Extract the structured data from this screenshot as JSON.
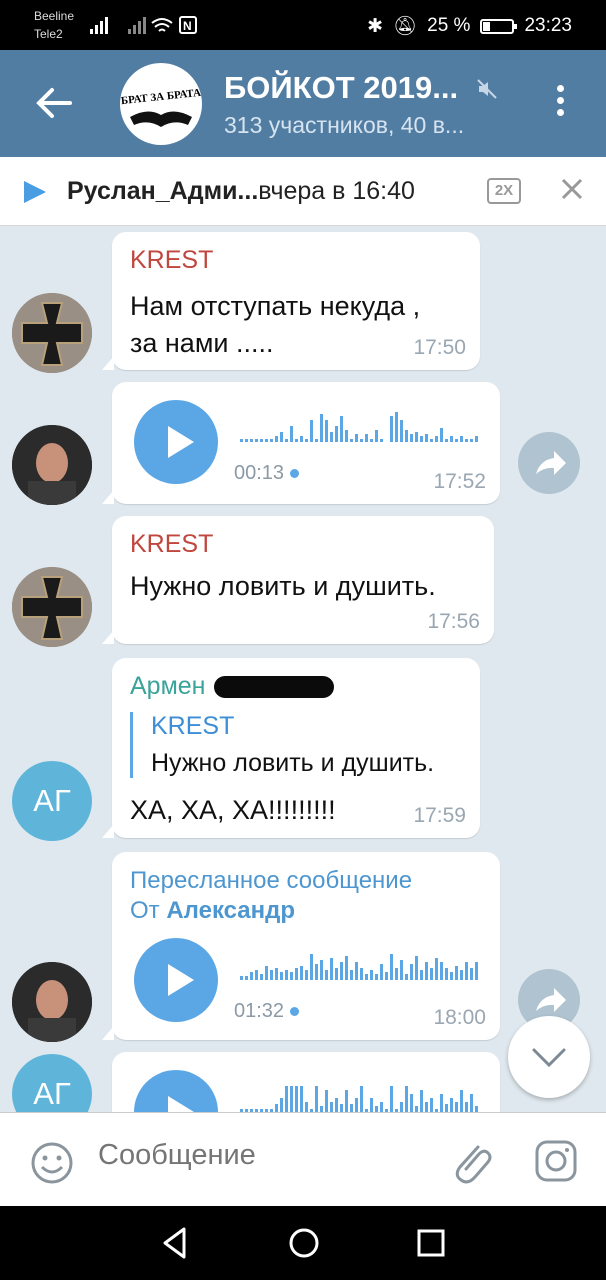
{
  "status": {
    "carrier1": "Beeline",
    "carrier2": "Tele2",
    "battery": "25 %",
    "time": "23:23"
  },
  "header": {
    "title": "БОЙКОТ 2019...",
    "subtitle": "313 участников, 40 в...",
    "avatar_text": "БРАТ ЗА БРАТА"
  },
  "player": {
    "name": "Руслан_Адми...",
    "when": "вчера в 16:40",
    "speed": "2X"
  },
  "messages": [
    {
      "sender": "KREST",
      "text1": "Нам отступать некуда ,",
      "text2": "за нами .....",
      "time": "17:50"
    },
    {
      "duration": "00:13",
      "time": "17:52"
    },
    {
      "sender": "KREST",
      "text": "Нужно ловить и душить.",
      "time": "17:56"
    },
    {
      "sender": "Армен",
      "reply_name": "KREST",
      "reply_text": "Нужно ловить и душить.",
      "text": "ХА, ХА, ХА!!!!!!!!!",
      "time": "17:59",
      "avatar": "АГ"
    },
    {
      "fwd_label": "Пересланное сообщение",
      "fwd_from_prefix": "От ",
      "fwd_from": "Александр",
      "duration": "01:32",
      "time": "18:00"
    },
    {
      "avatar": "АГ"
    }
  ],
  "input": {
    "placeholder": "Сообщение"
  },
  "colors": {
    "header": "#527da3",
    "accent": "#5ba7e6",
    "krest": "#c0463e",
    "armen": "#3aa39a"
  }
}
